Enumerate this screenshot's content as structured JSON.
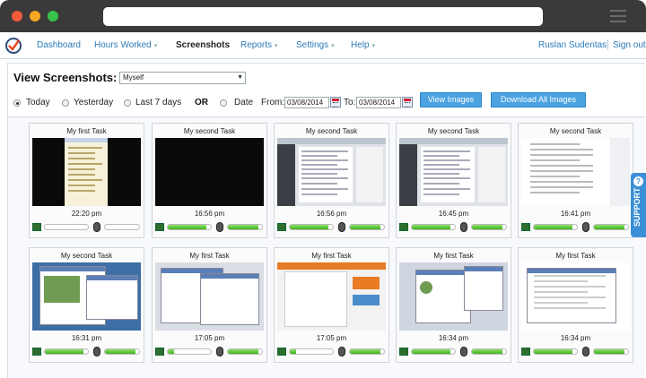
{
  "nav": {
    "items": [
      {
        "label": "Dashboard",
        "caret": ""
      },
      {
        "label": "Hours Worked",
        "caret": "▾"
      },
      {
        "label": "Screenshots",
        "caret": ""
      },
      {
        "label": "Reports",
        "caret": "▾"
      },
      {
        "label": "Settings",
        "caret": "▾"
      },
      {
        "label": "Help",
        "caret": "▾"
      }
    ],
    "active": "Screenshots",
    "user": "Ruslan Sudentas",
    "signout": "Sign out"
  },
  "view": {
    "heading": "View Screenshots:",
    "user_select": "Myself"
  },
  "filters": {
    "options": [
      "Today",
      "Yesterday",
      "Last 7 days"
    ],
    "selected": "Today",
    "or_label": "OR",
    "date_label": "Date",
    "from_label": "From:",
    "from_value": "03/08/2014",
    "to_label": "To:",
    "to_value": "03/08/2014",
    "view_button": "View Images",
    "download_button": "Download All Images"
  },
  "support_label": "SUPPORT",
  "support_icon": "question-icon",
  "colors": {
    "accent": "#4aa2e0",
    "link": "#2a7ab8",
    "activity": "#3db21d"
  },
  "screenshots": [
    {
      "task": "My first Task",
      "time": "22:20 pm",
      "kind": "doc",
      "keyboard_activity": 0.0,
      "mouse_activity": 0.0
    },
    {
      "task": "My second Task",
      "time": "16:56 pm",
      "kind": "black",
      "keyboard_activity": 0.9,
      "mouse_activity": 0.9
    },
    {
      "task": "My second Task",
      "time": "16:56 pm",
      "kind": "browser",
      "keyboard_activity": 0.9,
      "mouse_activity": 0.9
    },
    {
      "task": "My second Task",
      "time": "16:45 pm",
      "kind": "browser",
      "keyboard_activity": 0.9,
      "mouse_activity": 0.9
    },
    {
      "task": "My second Task",
      "time": "16:41 pm",
      "kind": "white",
      "keyboard_activity": 0.9,
      "mouse_activity": 0.9
    },
    {
      "task": "My second Task",
      "time": "16:31 pm",
      "kind": "windows",
      "keyboard_activity": 0.9,
      "mouse_activity": 0.9
    },
    {
      "task": "My first Task",
      "time": "17:05 pm",
      "kind": "windows2",
      "keyboard_activity": 0.15,
      "mouse_activity": 0.9
    },
    {
      "task": "My first Task",
      "time": "17:05 pm",
      "kind": "site",
      "keyboard_activity": 0.15,
      "mouse_activity": 0.9
    },
    {
      "task": "My first Task",
      "time": "16:34 pm",
      "kind": "windows3",
      "keyboard_activity": 0.9,
      "mouse_activity": 0.9
    },
    {
      "task": "My first Task",
      "time": "16:34 pm",
      "kind": "white2",
      "keyboard_activity": 0.9,
      "mouse_activity": 0.9
    }
  ]
}
